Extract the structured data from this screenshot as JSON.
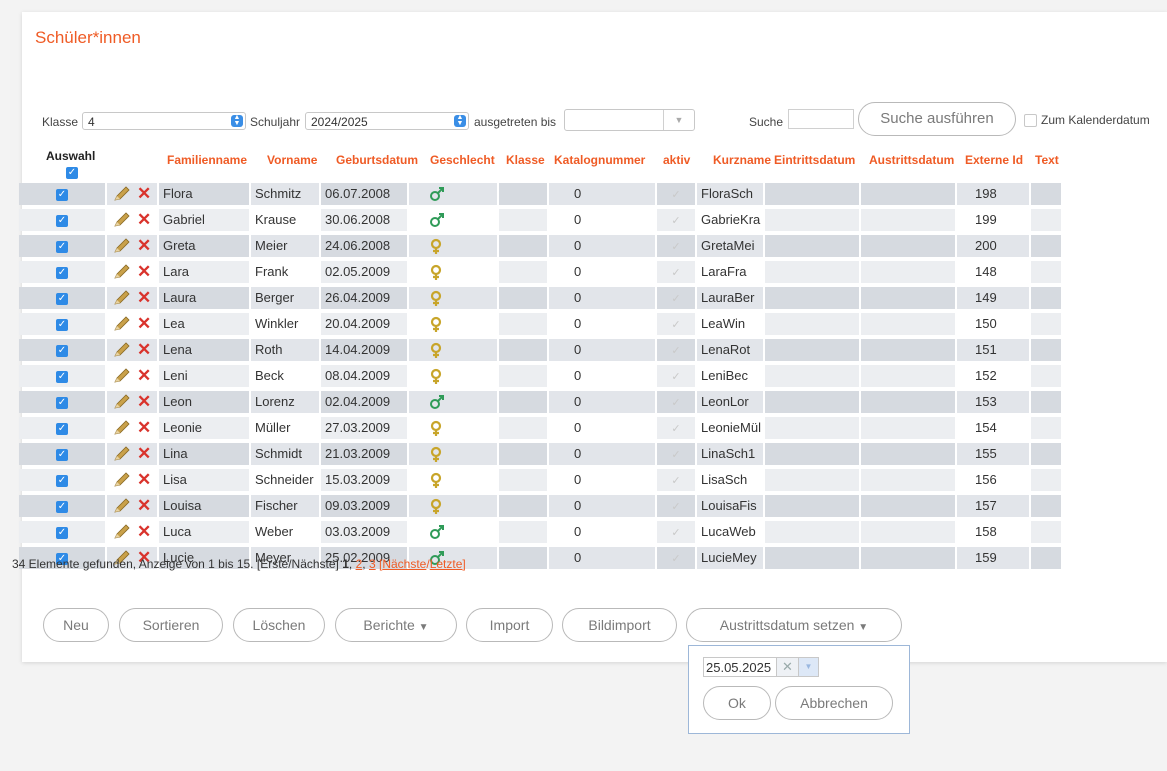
{
  "page": {
    "title": "Schüler*innen"
  },
  "filters": {
    "klasse_label": "Klasse",
    "klasse_value": "4",
    "schuljahr_label": "Schuljahr",
    "schuljahr_value": "2024/2025",
    "ausgetreten_label": "ausgetreten bis",
    "ausgetreten_value": "",
    "suche_label": "Suche",
    "suche_value": "",
    "suche_button": "Suche ausführen",
    "kalender_label": "Zum Kalenderdatum"
  },
  "table": {
    "auswahl_header": "Auswahl",
    "headers": [
      "Familienname",
      "Vorname",
      "Geburtsdatum",
      "Geschlecht",
      "Klasse",
      "Katalognummer",
      "aktiv",
      "Kurzname",
      "Eintrittsdatum",
      "Austrittsdatum",
      "Externe Id",
      "Text"
    ],
    "rows": [
      {
        "familienname": "Flora",
        "vorname": "Schmitz",
        "geburtsdatum": "06.07.2008",
        "geschlecht": "m",
        "katalognummer": "0",
        "kurzname": "FloraSch",
        "externe_id": "198"
      },
      {
        "familienname": "Gabriel",
        "vorname": "Krause",
        "geburtsdatum": "30.06.2008",
        "geschlecht": "m",
        "katalognummer": "0",
        "kurzname": "GabrieKra",
        "externe_id": "199"
      },
      {
        "familienname": "Greta",
        "vorname": "Meier",
        "geburtsdatum": "24.06.2008",
        "geschlecht": "w",
        "katalognummer": "0",
        "kurzname": "GretaMei",
        "externe_id": "200"
      },
      {
        "familienname": "Lara",
        "vorname": "Frank",
        "geburtsdatum": "02.05.2009",
        "geschlecht": "w",
        "katalognummer": "0",
        "kurzname": "LaraFra",
        "externe_id": "148"
      },
      {
        "familienname": "Laura",
        "vorname": "Berger",
        "geburtsdatum": "26.04.2009",
        "geschlecht": "w",
        "katalognummer": "0",
        "kurzname": "LauraBer",
        "externe_id": "149"
      },
      {
        "familienname": "Lea",
        "vorname": "Winkler",
        "geburtsdatum": "20.04.2009",
        "geschlecht": "w",
        "katalognummer": "0",
        "kurzname": "LeaWin",
        "externe_id": "150"
      },
      {
        "familienname": "Lena",
        "vorname": "Roth",
        "geburtsdatum": "14.04.2009",
        "geschlecht": "w",
        "katalognummer": "0",
        "kurzname": "LenaRot",
        "externe_id": "151"
      },
      {
        "familienname": "Leni",
        "vorname": "Beck",
        "geburtsdatum": "08.04.2009",
        "geschlecht": "w",
        "katalognummer": "0",
        "kurzname": "LeniBec",
        "externe_id": "152"
      },
      {
        "familienname": "Leon",
        "vorname": "Lorenz",
        "geburtsdatum": "02.04.2009",
        "geschlecht": "m",
        "katalognummer": "0",
        "kurzname": "LeonLor",
        "externe_id": "153"
      },
      {
        "familienname": "Leonie",
        "vorname": "Müller",
        "geburtsdatum": "27.03.2009",
        "geschlecht": "w",
        "katalognummer": "0",
        "kurzname": "LeonieMül",
        "externe_id": "154"
      },
      {
        "familienname": "Lina",
        "vorname": "Schmidt",
        "geburtsdatum": "21.03.2009",
        "geschlecht": "w",
        "katalognummer": "0",
        "kurzname": "LinaSch1",
        "externe_id": "155"
      },
      {
        "familienname": "Lisa",
        "vorname": "Schneider",
        "geburtsdatum": "15.03.2009",
        "geschlecht": "w",
        "katalognummer": "0",
        "kurzname": "LisaSch",
        "externe_id": "156"
      },
      {
        "familienname": "Louisa",
        "vorname": "Fischer",
        "geburtsdatum": "09.03.2009",
        "geschlecht": "w",
        "katalognummer": "0",
        "kurzname": "LouisaFis",
        "externe_id": "157"
      },
      {
        "familienname": "Luca",
        "vorname": "Weber",
        "geburtsdatum": "03.03.2009",
        "geschlecht": "m",
        "katalognummer": "0",
        "kurzname": "LucaWeb",
        "externe_id": "158"
      },
      {
        "familienname": "Lucie",
        "vorname": "Meyer",
        "geburtsdatum": "25.02.2009",
        "geschlecht": "m",
        "katalognummer": "0",
        "kurzname": "LucieMey",
        "externe_id": "159"
      }
    ],
    "icons": {
      "edit": "pencil-icon",
      "delete": "delete-x-icon",
      "male": "male-symbol-icon",
      "female": "female-symbol-icon",
      "aktiv": "checkmark-icon"
    }
  },
  "status": {
    "summary": "34 Elemente gefunden, Anzeige von 1 bis 15.",
    "nav_prefix": "[Erste/Nächste]",
    "page_current": "1",
    "page_2": "2",
    "page_3": "3",
    "next_link": "Nächste",
    "last_link": "Letzte"
  },
  "actions": {
    "neu": "Neu",
    "sortieren": "Sortieren",
    "loeschen": "Löschen",
    "berichte": "Berichte",
    "import": "Import",
    "bildimport": "Bildimport",
    "austrittsdatum": "Austrittsdatum setzen"
  },
  "popup": {
    "date_value": "25.05.2025",
    "ok": "Ok",
    "cancel": "Abbrechen"
  },
  "colors": {
    "accent": "#ef5b25",
    "checkbox": "#2e8ae6",
    "row_alt": "#e2e5ea",
    "male": "#2f9b58",
    "female": "#c8a52a"
  }
}
